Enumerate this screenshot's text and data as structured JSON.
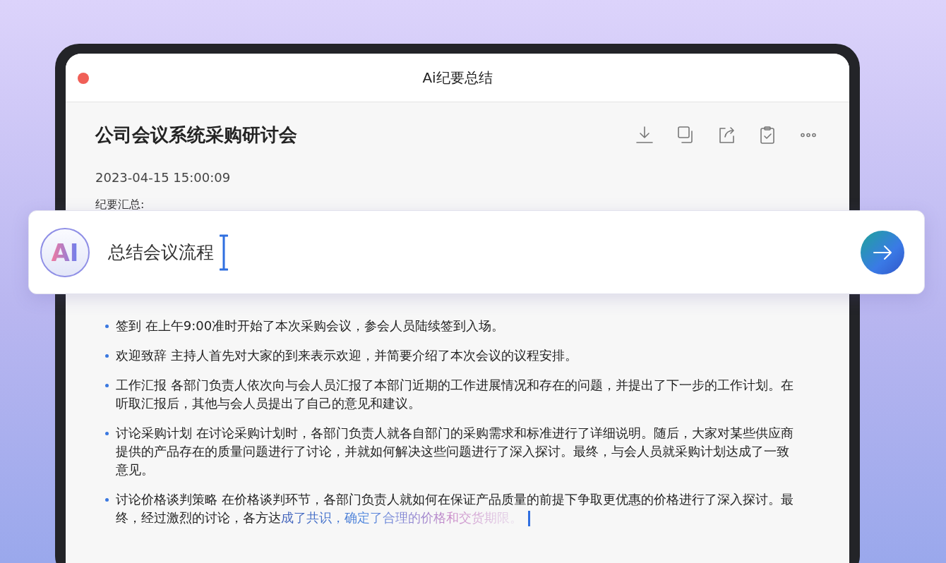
{
  "window": {
    "title": "Ai纪要总结"
  },
  "document": {
    "title": "公司会议系统采购研讨会",
    "timestamp": "2023-04-15 15:00:09",
    "section_label": "纪要汇总:",
    "toolbar": [
      {
        "kind": "download"
      },
      {
        "kind": "copy"
      },
      {
        "kind": "share"
      },
      {
        "kind": "clipboard"
      },
      {
        "kind": "more"
      }
    ],
    "items": [
      {
        "text": "签到 在上午9:00准时开始了本次采购会议，参会人员陆续签到入场。"
      },
      {
        "text": "欢迎致辞 主持人首先对大家的到来表示欢迎，并简要介绍了本次会议的议程安排。"
      },
      {
        "text": "工作汇报 各部门负责人依次向与会人员汇报了本部门近期的工作进展情况和存在的问题，并提出了下一步的工作计划。在听取汇报后，其他与会人员提出了自己的意见和建议。"
      },
      {
        "text": "讨论采购计划 在讨论采购计划时，各部门负责人就各自部门的采购需求和标准进行了详细说明。随后，大家对某些供应商提供的产品存在的质量问题进行了讨论，并就如何解决这些问题进行了深入探讨。最终，与会人员就采购计划达成了一致意见。"
      },
      {
        "text": "讨论价格谈判策略 在价格谈判环节，各部门负责人就如何在保证产品质量的前提下争取更优惠的价格进行了深入探讨。最终，经过激烈的讨论，各方达",
        "streaming_text": "成了共识，确定了合理的价格和交货期限。"
      }
    ]
  },
  "prompt": {
    "logo_text": "AI",
    "value": "总结会议流程"
  }
}
